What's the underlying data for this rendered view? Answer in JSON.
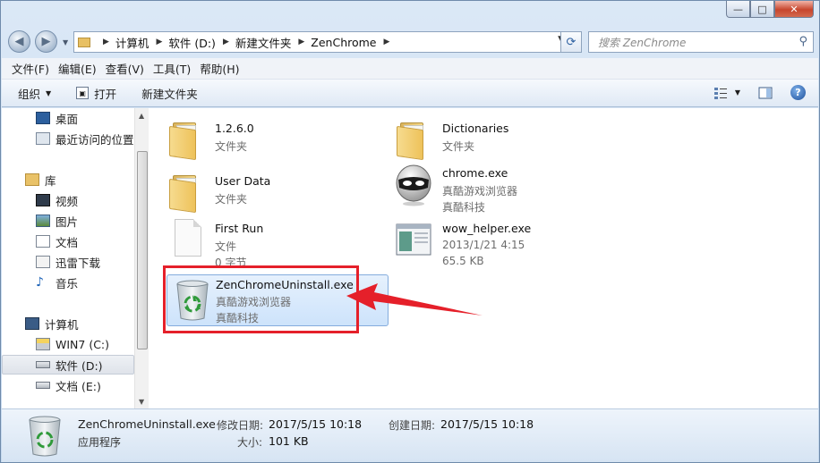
{
  "window": {
    "caption_buttons": [
      "—",
      "□",
      "✕"
    ]
  },
  "nav": {
    "breadcrumbs": [
      "计算机",
      "软件 (D:)",
      "新建文件夹",
      "ZenChrome"
    ],
    "search_placeholder": "搜索 ZenChrome"
  },
  "menu": [
    "文件(F)",
    "编辑(E)",
    "查看(V)",
    "工具(T)",
    "帮助(H)"
  ],
  "toolbar": {
    "organize": "组织",
    "open": "打开",
    "new_folder": "新建文件夹"
  },
  "sidebar": [
    {
      "label": "桌面",
      "icon": "desktop-icon"
    },
    {
      "label": "最近访问的位置",
      "icon": "recent-places-icon"
    },
    {
      "label": "库",
      "icon": "library-icon"
    },
    {
      "label": "视频",
      "icon": "video-icon"
    },
    {
      "label": "图片",
      "icon": "picture-icon"
    },
    {
      "label": "文档",
      "icon": "document-icon"
    },
    {
      "label": "迅雷下载",
      "icon": "download-icon"
    },
    {
      "label": "音乐",
      "icon": "music-icon"
    },
    {
      "label": "计算机",
      "icon": "computer-icon"
    },
    {
      "label": "WIN7 (C:)",
      "icon": "system-drive-icon"
    },
    {
      "label": "软件 (D:)",
      "icon": "drive-icon"
    },
    {
      "label": "文档 (E:)",
      "icon": "drive-icon"
    }
  ],
  "files": [
    {
      "name": "1.2.6.0",
      "line2": "文件夹",
      "line3": "",
      "icon": "folder-icon"
    },
    {
      "name": "Dictionaries",
      "line2": "文件夹",
      "line3": "",
      "icon": "folder-icon"
    },
    {
      "name": "User Data",
      "line2": "文件夹",
      "line3": "",
      "icon": "folder-icon"
    },
    {
      "name": "chrome.exe",
      "line2": "真酷游戏浏览器",
      "line3": "真酷科技",
      "icon": "ninja-app-icon"
    },
    {
      "name": "First Run",
      "line2": "文件",
      "line3": "0 字节",
      "icon": "file-icon"
    },
    {
      "name": "wow_helper.exe",
      "line2": "2013/1/21 4:15",
      "line3": "65.5 KB",
      "icon": "exe-window-icon"
    },
    {
      "name": "ZenChromeUninstall.exe",
      "line2": "真酷游戏浏览器",
      "line3": "真酷科技",
      "icon": "recycle-bin-icon"
    }
  ],
  "status": {
    "name": "ZenChromeUninstall.exe",
    "type": "应用程序",
    "modified_label": "修改日期:",
    "modified_value": "2017/5/15 10:18",
    "created_label": "创建日期:",
    "created_value": "2017/5/15 10:18",
    "size_label": "大小:",
    "size_value": "101 KB"
  },
  "colors": {
    "annotation": "#e5202a",
    "selection": "#cde3fb",
    "chrome": "#c4d8ee"
  }
}
